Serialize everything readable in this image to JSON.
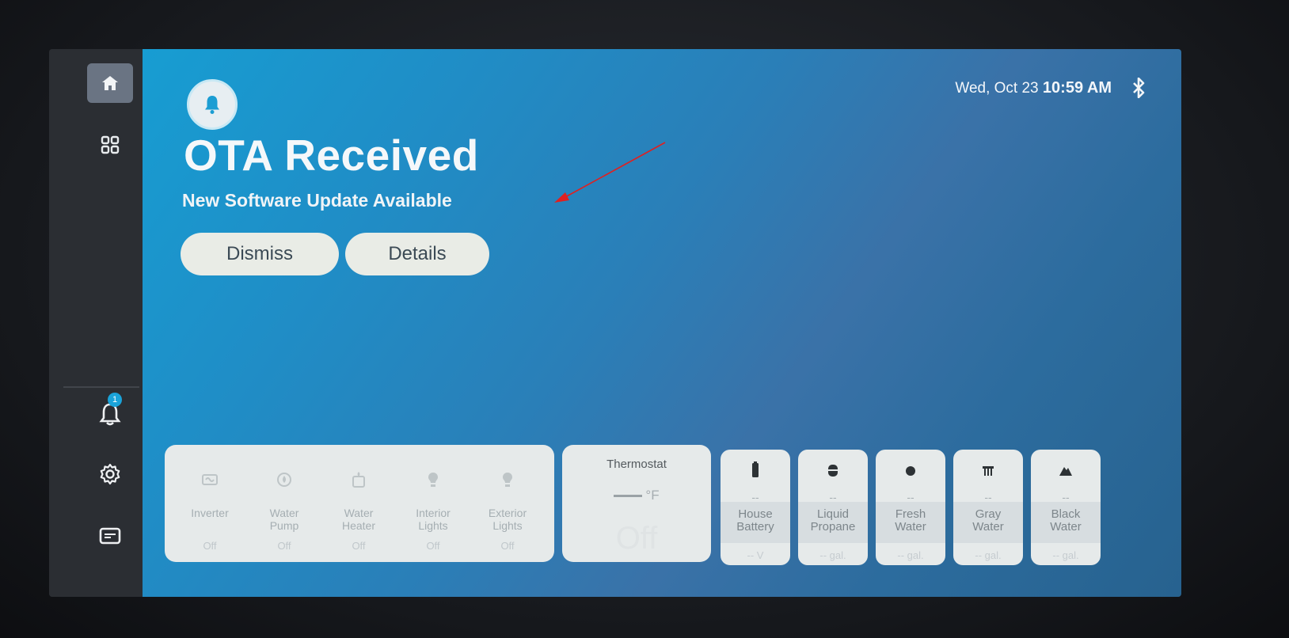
{
  "header": {
    "date": "Wed, Oct 23",
    "time": "10:59 AM"
  },
  "notification": {
    "title": "OTA Received",
    "subtitle": "New Software Update Available",
    "dismiss_label": "Dismiss",
    "details_label": "Details"
  },
  "sidebar": {
    "notification_count": "1"
  },
  "controls": [
    {
      "label_1": "Inverter",
      "label_2": "",
      "state": "Off"
    },
    {
      "label_1": "Water",
      "label_2": "Pump",
      "state": "Off"
    },
    {
      "label_1": "Water",
      "label_2": "Heater",
      "state": "Off"
    },
    {
      "label_1": "Interior",
      "label_2": "Lights",
      "state": "Off"
    },
    {
      "label_1": "Exterior",
      "label_2": "Lights",
      "state": "Off"
    }
  ],
  "thermostat": {
    "title": "Thermostat",
    "unit": "°F",
    "state": "Off"
  },
  "tanks": [
    {
      "name_1": "House",
      "name_2": "Battery",
      "level": "--",
      "value": "-- V"
    },
    {
      "name_1": "Liquid",
      "name_2": "Propane",
      "level": "--",
      "value": "-- gal."
    },
    {
      "name_1": "Fresh",
      "name_2": "Water",
      "level": "--",
      "value": "-- gal."
    },
    {
      "name_1": "Gray",
      "name_2": "Water",
      "level": "--",
      "value": "-- gal."
    },
    {
      "name_1": "Black",
      "name_2": "Water",
      "level": "--",
      "value": "-- gal."
    }
  ],
  "colors": {
    "accent": "#179dd2",
    "annotation_arrow": "#e02020"
  }
}
